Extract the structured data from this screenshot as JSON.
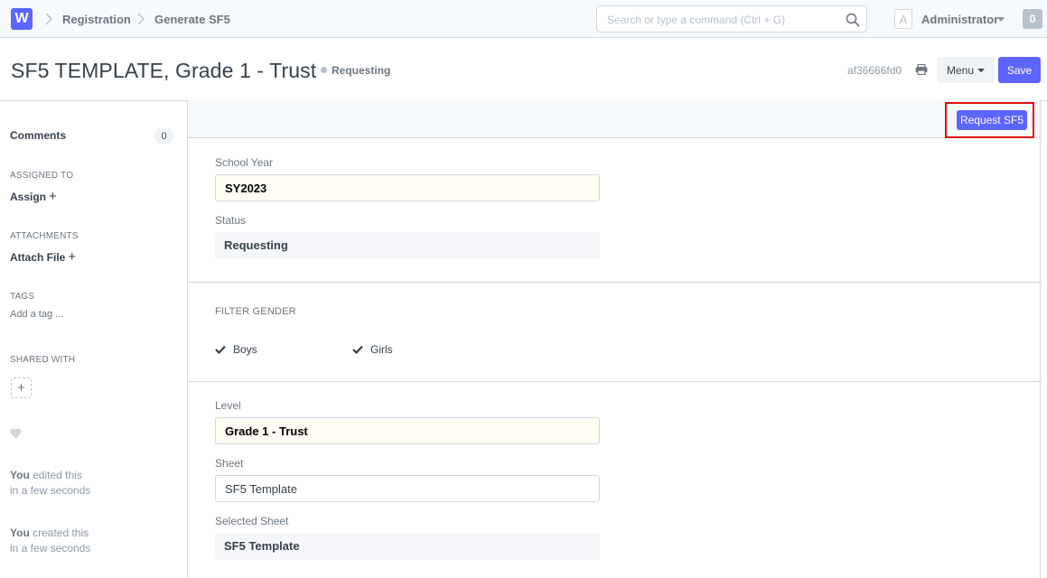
{
  "navbar": {
    "logo_letter": "W",
    "breadcrumbs": [
      "Registration",
      "Generate SF5"
    ],
    "search_placeholder": "Search or type a command (Ctrl + G)",
    "avatar_letter": "A",
    "user_name": "Administrator",
    "notification_count": "0"
  },
  "page": {
    "title": "SF5 TEMPLATE, Grade 1 - Trust",
    "status": "Requesting",
    "doc_name": "af36666fd0",
    "menu_label": "Menu",
    "save_label": "Save"
  },
  "sidebar": {
    "comments_label": "Comments",
    "comments_count": "0",
    "assigned_to_label": "ASSIGNED TO",
    "assign_label": "Assign",
    "attachments_label": "ATTACHMENTS",
    "attach_label": "Attach File",
    "tags_label": "TAGS",
    "add_tag_label": "Add a tag ...",
    "shared_with_label": "SHARED WITH",
    "activity": [
      {
        "who": "You",
        "action": " edited this",
        "when": "in a few seconds"
      },
      {
        "who": "You",
        "action": " created this",
        "when": "in a few seconds"
      }
    ]
  },
  "form": {
    "request_button_label": "Request SF5",
    "school_year": {
      "label": "School Year",
      "value": "SY2023"
    },
    "status": {
      "label": "Status",
      "value": "Requesting"
    },
    "filter_gender": {
      "heading": "FILTER GENDER",
      "options": [
        {
          "label": "Boys",
          "checked": true
        },
        {
          "label": "Girls",
          "checked": true
        }
      ]
    },
    "level": {
      "label": "Level",
      "value": "Grade 1 - Trust"
    },
    "sheet": {
      "label": "Sheet",
      "value": "SF5 Template"
    },
    "selected_sheet": {
      "label": "Selected Sheet",
      "value": "SF5 Template"
    }
  },
  "colors": {
    "primary": "#5e64ff",
    "highlight_border": "#e30d0d",
    "text": "#36414c",
    "muted": "#6c7680"
  }
}
